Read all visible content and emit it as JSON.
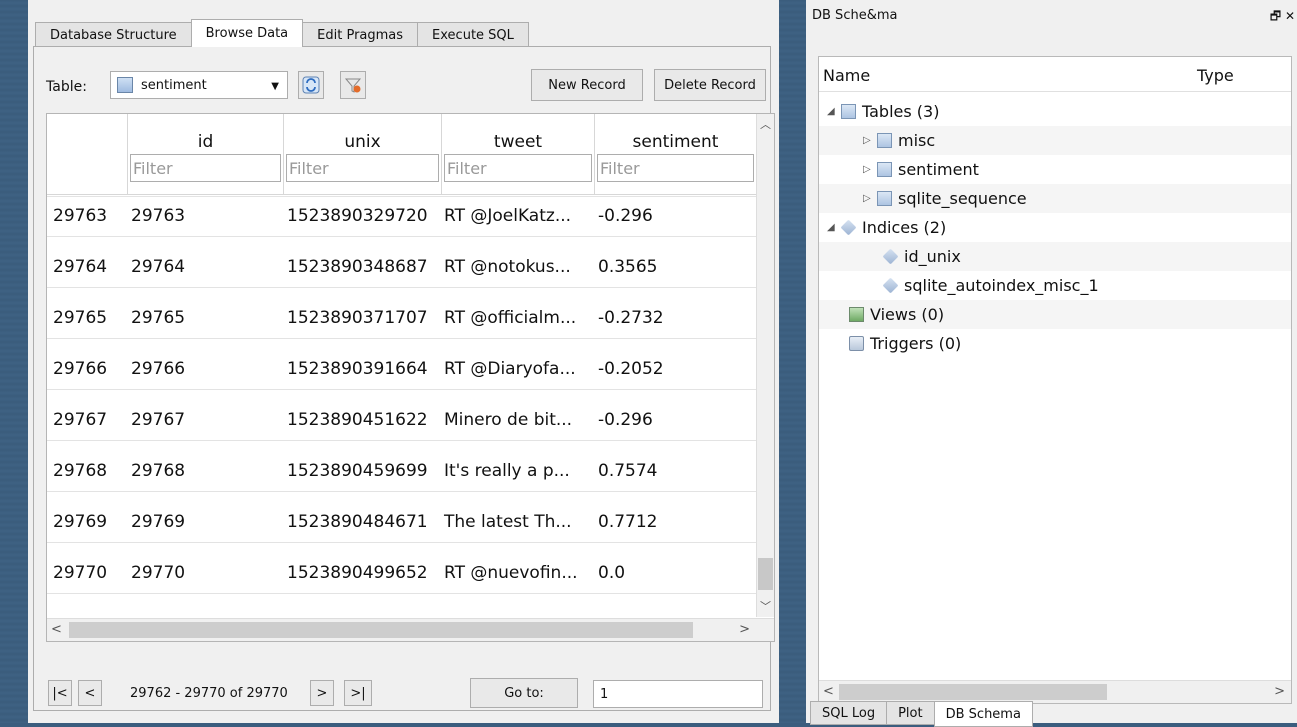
{
  "tabs": [
    "Database Structure",
    "Browse Data",
    "Edit Pragmas",
    "Execute SQL"
  ],
  "active_tab": "Browse Data",
  "toolbar": {
    "table_label": "Table:",
    "table_value": "sentiment",
    "new_record": "New Record",
    "delete_record": "Delete Record"
  },
  "grid": {
    "columns": [
      "id",
      "unix",
      "tweet",
      "sentiment"
    ],
    "filter_placeholder": "Filter",
    "rows": [
      {
        "rownum": "29763",
        "id": "29763",
        "unix": "1523890329720",
        "tweet": "RT @JoelKatz...",
        "sentiment": "-0.296"
      },
      {
        "rownum": "29764",
        "id": "29764",
        "unix": "1523890348687",
        "tweet": "RT @notokus...",
        "sentiment": "0.3565"
      },
      {
        "rownum": "29765",
        "id": "29765",
        "unix": "1523890371707",
        "tweet": "RT @officialm...",
        "sentiment": "-0.2732"
      },
      {
        "rownum": "29766",
        "id": "29766",
        "unix": "1523890391664",
        "tweet": "RT @Diaryofa...",
        "sentiment": "-0.2052"
      },
      {
        "rownum": "29767",
        "id": "29767",
        "unix": "1523890451622",
        "tweet": "Minero de bit...",
        "sentiment": "-0.296"
      },
      {
        "rownum": "29768",
        "id": "29768",
        "unix": "1523890459699",
        "tweet": "It's really a p...",
        "sentiment": "0.7574"
      },
      {
        "rownum": "29769",
        "id": "29769",
        "unix": "1523890484671",
        "tweet": "The latest Th...",
        "sentiment": "0.7712"
      },
      {
        "rownum": "29770",
        "id": "29770",
        "unix": "1523890499652",
        "tweet": "RT @nuevofin...",
        "sentiment": "0.0"
      }
    ]
  },
  "pager": {
    "first": "|<",
    "prev": "<",
    "range": "29762 - 29770 of 29770",
    "next": ">",
    "last": ">|",
    "goto_label": "Go to:",
    "goto_value": "1"
  },
  "schema": {
    "title": "DB Sche&ma",
    "col_name": "Name",
    "col_type": "Type",
    "items": [
      {
        "label": "Tables (3)",
        "icon": "table-icon"
      },
      {
        "label": "misc",
        "icon": "table-icon"
      },
      {
        "label": "sentiment",
        "icon": "table-icon"
      },
      {
        "label": "sqlite_sequence",
        "icon": "table-icon"
      },
      {
        "label": "Indices (2)",
        "icon": "index-icon"
      },
      {
        "label": "id_unix",
        "icon": "index-icon"
      },
      {
        "label": "sqlite_autoindex_misc_1",
        "icon": "index-icon"
      },
      {
        "label": "Views (0)",
        "icon": "view-icon"
      },
      {
        "label": "Triggers (0)",
        "icon": "trigger-icon"
      }
    ]
  },
  "bottom_tabs": [
    "SQL Log",
    "Plot",
    "DB Schema"
  ],
  "active_bottom_tab": "DB Schema"
}
